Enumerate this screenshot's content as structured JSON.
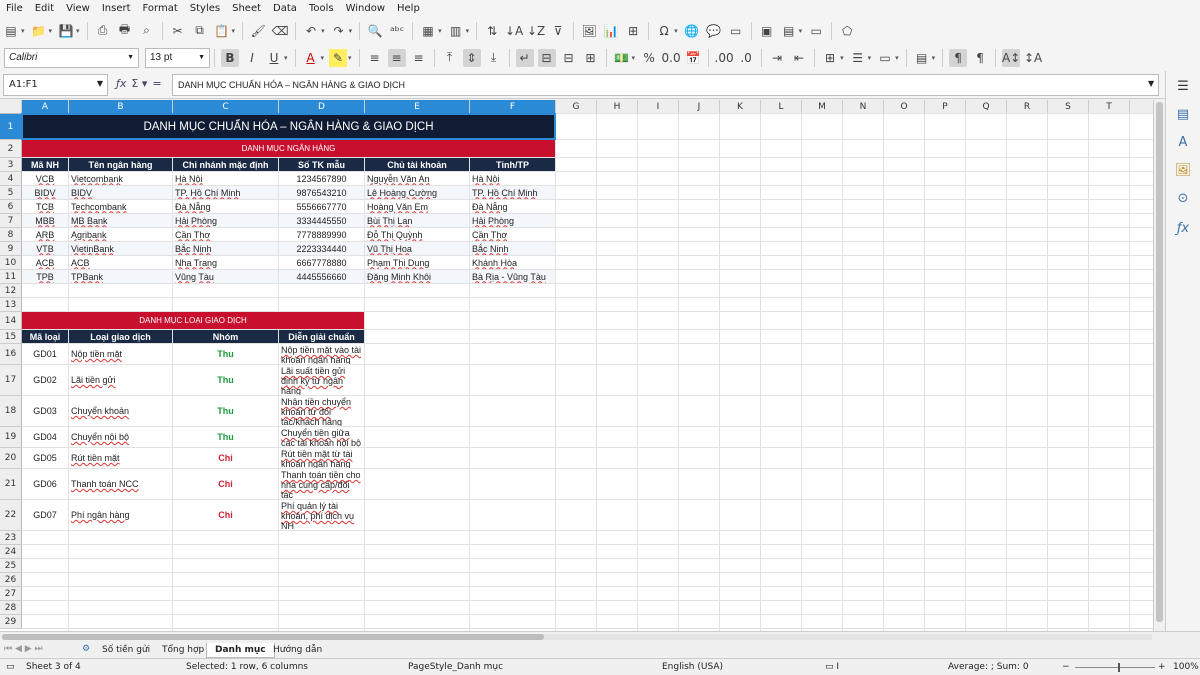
{
  "menu": [
    "File",
    "Edit",
    "View",
    "Insert",
    "Format",
    "Styles",
    "Sheet",
    "Data",
    "Tools",
    "Window",
    "Help"
  ],
  "font_name": "Calibri",
  "font_size": "13 pt",
  "name_box": "A1:F1",
  "formula": "DANH MỤC CHUẨN HÓA – NGÂN HÀNG & GIAO DỊCH",
  "columns": [
    "A",
    "B",
    "C",
    "D",
    "E",
    "F",
    "G",
    "H",
    "I",
    "J",
    "K",
    "L",
    "M",
    "N",
    "O",
    "P",
    "Q",
    "R",
    "S",
    "T"
  ],
  "rows": [
    "1",
    "2",
    "3",
    "4",
    "5",
    "6",
    "7",
    "8",
    "9",
    "10",
    "11",
    "12",
    "13",
    "14",
    "15",
    "16",
    "17",
    "18",
    "19",
    "20",
    "21",
    "22",
    "23",
    "24",
    "25",
    "26",
    "27",
    "28",
    "29"
  ],
  "sheet": {
    "title": "DANH MỤC CHUẨN HÓA – NGÂN HÀNG & GIAO DỊCH",
    "bank_section": "DANH MỤC NGÂN HÀNG",
    "bank_headers": [
      "Mã NH",
      "Tên ngân hàng",
      "Chi nhánh mặc định",
      "Số TK mẫu",
      "Chủ tài khoản",
      "Tỉnh/TP"
    ],
    "banks": [
      [
        "VCB",
        "Vietcombank",
        "Hà Nội",
        "1234567890",
        "Nguyễn Văn An",
        "Hà Nội"
      ],
      [
        "BIDV",
        "BIDV",
        "TP. Hồ Chí Minh",
        "9876543210",
        "Lê Hoàng Cường",
        "TP. Hồ Chí Minh"
      ],
      [
        "TCB",
        "Techcombank",
        "Đà Nẵng",
        "5556667770",
        "Hoàng Văn Em",
        "Đà Nẵng"
      ],
      [
        "MBB",
        "MB Bank",
        "Hải Phòng",
        "3334445550",
        "Bùi Thị Lan",
        "Hải Phòng"
      ],
      [
        "ARB",
        "Agribank",
        "Cần Thơ",
        "7778889990",
        "Đỗ Thị Quỳnh",
        "Cần Thơ"
      ],
      [
        "VTB",
        "VietinBank",
        "Bắc Ninh",
        "2223334440",
        "Vũ Thị Hoa",
        "Bắc Ninh"
      ],
      [
        "ACB",
        "ACB",
        "Nha Trang",
        "6667778880",
        "Phạm Thị Dung",
        "Khánh Hòa"
      ],
      [
        "TPB",
        "TPBank",
        "Vũng Tàu",
        "4445556660",
        "Đặng Minh Khôi",
        "Bà Rịa - Vũng Tàu"
      ]
    ],
    "tx_section": "DANH MỤC LOẠI GIAO DỊCH",
    "tx_headers": [
      "Mã loại",
      "Loại giao dịch",
      "Nhóm",
      "Diễn giải chuẩn"
    ],
    "transactions": [
      [
        "GD01",
        "Nộp tiền mặt",
        "Thu",
        "Nộp tiền mặt vào tài khoản ngân hàng"
      ],
      [
        "GD02",
        "Lãi tiền gửi",
        "Thu",
        "Lãi suất tiền gửi định kỳ từ ngân hàng"
      ],
      [
        "GD03",
        "Chuyển khoản",
        "Thu",
        "Nhận tiền chuyển khoản từ đối tác/khách hàng"
      ],
      [
        "GD04",
        "Chuyển nội bộ",
        "Thu",
        "Chuyển tiền giữa các tài khoản nội bộ"
      ],
      [
        "GD05",
        "Rút tiền mặt",
        "Chi",
        "Rút tiền mặt từ tài khoản ngân hàng"
      ],
      [
        "GD06",
        "Thanh toán NCC",
        "Chi",
        "Thanh toán tiền cho nhà cung cấp/đối tác"
      ],
      [
        "GD07",
        "Phí ngân hàng",
        "Chi",
        "Phí quản lý tài khoản, phí dịch vụ NH"
      ]
    ]
  },
  "tabs": [
    "Số tiền gửi",
    "Tổng hợp",
    "Danh mục",
    "Hướng dẫn"
  ],
  "active_tab": "Danh mục",
  "status": {
    "sheet": "Sheet 3 of 4",
    "selection": "Selected: 1 row, 6 columns",
    "page_style": "PageStyle_Danh mục",
    "language": "English (USA)",
    "summary": "Average: ; Sum: 0",
    "zoom": "100%"
  }
}
